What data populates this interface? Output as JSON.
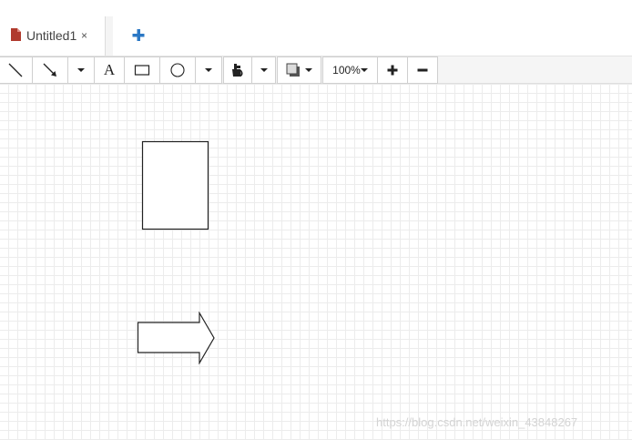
{
  "tabs": [
    {
      "label": "Untitled1",
      "close": "×",
      "icon": "file-icon",
      "active": true
    }
  ],
  "add_tab_icon": "plus-icon",
  "toolbar": {
    "line_tool_icon": "line-icon",
    "arrow_tool_icon": "arrow-line-icon",
    "text_tool_label": "A",
    "rect_tool_icon": "rectangle-icon",
    "ellipse_tool_icon": "ellipse-icon",
    "fill_tool_icon": "paint-bucket-icon",
    "shadow_tool_icon": "shadow-icon",
    "zoom_label": "100%",
    "zoom_in_icon": "plus-icon",
    "zoom_out_icon": "minus-icon"
  },
  "canvas": {
    "shapes": [
      {
        "type": "rectangle",
        "stroke": "#222222",
        "fill": "#ffffff"
      },
      {
        "type": "block-arrow",
        "direction": "right",
        "stroke": "#222222",
        "fill": "#ffffff"
      }
    ]
  },
  "watermark": "https://blog.csdn.net/weixin_43848267",
  "colors": {
    "file_icon": "#c0392b",
    "add_tab": "#2b78c5",
    "grid": "#ececec"
  }
}
